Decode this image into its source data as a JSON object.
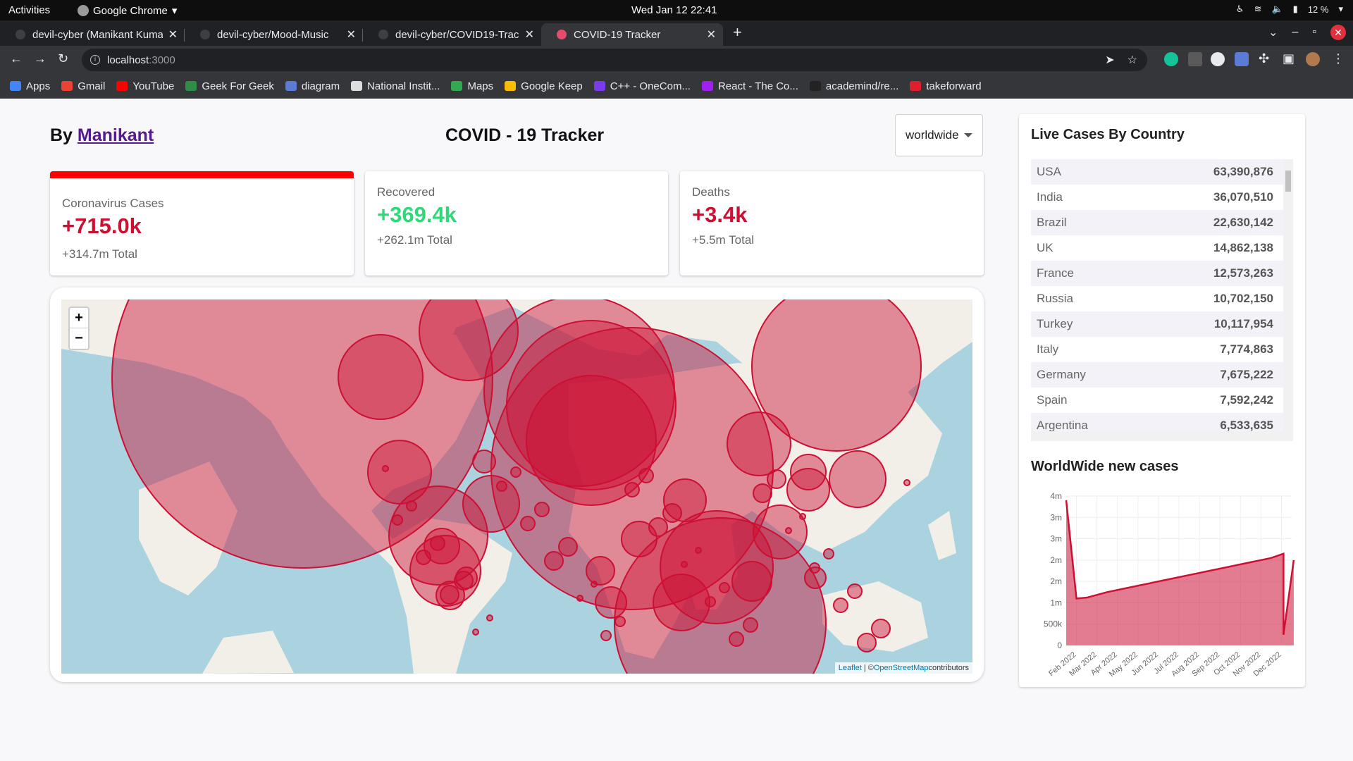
{
  "os_bar": {
    "activities": "Activities",
    "app": "Google Chrome",
    "clock": "Wed Jan 12  22:41",
    "battery": "12 %"
  },
  "tabs": [
    {
      "title": "devil-cyber (Manikant Kumar)",
      "active": false
    },
    {
      "title": "devil-cyber/Mood-Music",
      "active": false
    },
    {
      "title": "devil-cyber/COVID19-Tracker",
      "active": false
    },
    {
      "title": "COVID-19 Tracker",
      "active": true
    }
  ],
  "address": {
    "host": "localhost",
    "port": ":3000"
  },
  "bookmarks": [
    {
      "label": "Apps",
      "color": "#4285f4"
    },
    {
      "label": "Gmail",
      "color": "#ea4335"
    },
    {
      "label": "YouTube",
      "color": "#ff0000"
    },
    {
      "label": "Geek For Geek",
      "color": "#2f8d46"
    },
    {
      "label": "diagram",
      "color": "#5b7bd5"
    },
    {
      "label": "National Instit...",
      "color": "#dddddd"
    },
    {
      "label": "Maps",
      "color": "#34a853"
    },
    {
      "label": "Google Keep",
      "color": "#fbbc04"
    },
    {
      "label": "C++ - OneCom...",
      "color": "#7c3aed"
    },
    {
      "label": "React - The Co...",
      "color": "#a020f0"
    },
    {
      "label": "academind/re...",
      "color": "#222222"
    },
    {
      "label": "takeforward",
      "color": "#e01e2e"
    }
  ],
  "header": {
    "by": "By ",
    "author": "Manikant",
    "title": "COVID - 19 Tracker",
    "select_value": "worldwide"
  },
  "infoboxes": [
    {
      "title": "Coronavirus Cases",
      "cases": "+715.0k",
      "total": "+314.7m Total"
    },
    {
      "title": "Recovered",
      "cases": "+369.4k",
      "total": "+262.1m Total"
    },
    {
      "title": "Deaths",
      "cases": "+3.4k",
      "total": "+5.5m Total"
    }
  ],
  "map": {
    "zoom_in": "+",
    "zoom_out": "−",
    "attribution_leaflet": "Leaflet",
    "attribution_sep": " | ©",
    "attribution_osm": "OpenStreetMap",
    "attribution_tail": "contributors"
  },
  "sidebar": {
    "table_title": "Live Cases By Country",
    "countries": [
      {
        "country": "USA",
        "cases": "63,390,876"
      },
      {
        "country": "India",
        "cases": "36,070,510"
      },
      {
        "country": "Brazil",
        "cases": "22,630,142"
      },
      {
        "country": "UK",
        "cases": "14,862,138"
      },
      {
        "country": "France",
        "cases": "12,573,263"
      },
      {
        "country": "Russia",
        "cases": "10,702,150"
      },
      {
        "country": "Turkey",
        "cases": "10,117,954"
      },
      {
        "country": "Italy",
        "cases": "7,774,863"
      },
      {
        "country": "Germany",
        "cases": "7,675,222"
      },
      {
        "country": "Spain",
        "cases": "7,592,242"
      },
      {
        "country": "Argentina",
        "cases": "6,533,635"
      }
    ],
    "chart_title": "WorldWide new cases"
  },
  "chart_data": {
    "type": "area",
    "title": "WorldWide new cases",
    "y_ticks": [
      "4m",
      "3m",
      "3m",
      "2m",
      "2m",
      "1m",
      "500k",
      "0"
    ],
    "x_ticks": [
      "Feb 2022",
      "Mar 2022",
      "Apr 2022",
      "May 2022",
      "Jun 2022",
      "Jul 2022",
      "Aug 2022",
      "Sep 2022",
      "Oct 2022",
      "Nov 2022",
      "Dec 2022"
    ],
    "ylim": [
      0,
      3500000
    ],
    "color": "#cc1034",
    "fill": "rgba(204,16,52,0.55)",
    "series": [
      {
        "x": [
          0,
          0.5,
          1,
          2,
          3,
          4,
          5,
          6,
          7,
          8,
          9,
          10,
          10.6,
          10.6,
          11.1
        ],
        "y": [
          3400000,
          1100000,
          1120000,
          1250000,
          1350000,
          1450000,
          1550000,
          1650000,
          1750000,
          1850000,
          1950000,
          2050000,
          2150000,
          250000,
          2000000
        ]
      }
    ]
  }
}
